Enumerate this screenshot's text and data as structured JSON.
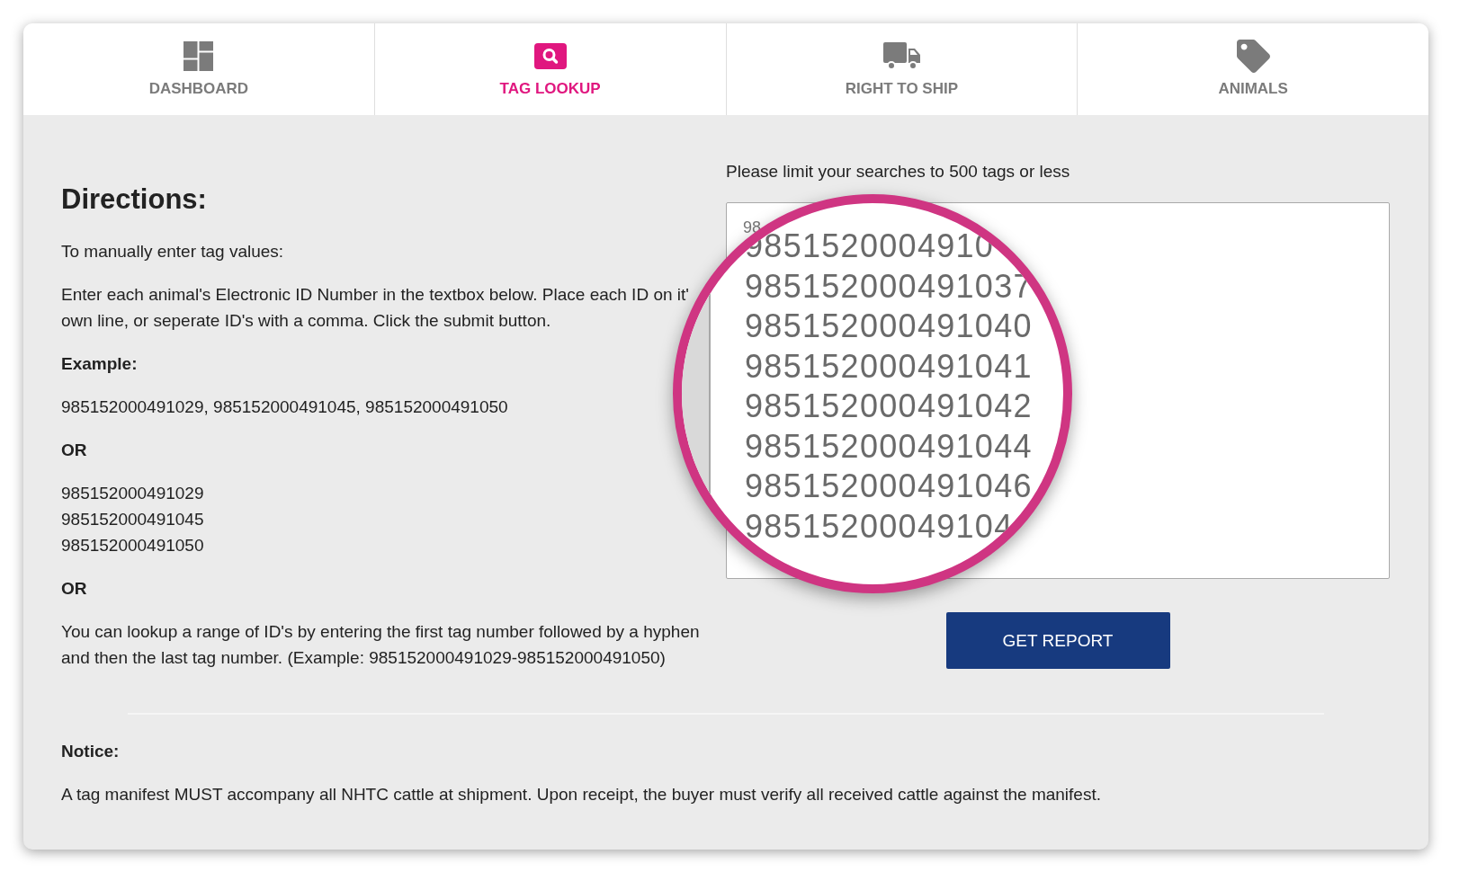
{
  "tabs": [
    {
      "label": "DASHBOARD",
      "selected": false
    },
    {
      "label": "TAG LOOKUP",
      "selected": true
    },
    {
      "label": "RIGHT TO SHIP",
      "selected": false
    },
    {
      "label": "ANIMALS",
      "selected": false
    }
  ],
  "directions": {
    "title": "Directions:",
    "blocks": [
      {
        "kind": "text",
        "text": "To manually enter tag values:"
      },
      {
        "kind": "lines",
        "lines": [
          "Enter each animal's Electronic ID Number in the textbox below. Place each ID on it'",
          "own line, or seperate ID's with a comma. Click the submit button."
        ]
      },
      {
        "kind": "heading",
        "text": "Example:"
      },
      {
        "kind": "text",
        "text": "985152000491029, 985152000491045, 985152000491050"
      },
      {
        "kind": "heading",
        "text": "OR"
      },
      {
        "kind": "lines",
        "lines": [
          "985152000491029",
          "985152000491045",
          "985152000491050"
        ]
      },
      {
        "kind": "heading",
        "text": "OR"
      },
      {
        "kind": "text",
        "text": "You can lookup a range of ID's by entering the first tag number followed by a hyphen and then the last tag number. (Example: 985152000491029-985152000491050)"
      }
    ]
  },
  "search": {
    "limit_note": "Please limit your searches to 500 tags or less",
    "value": "98",
    "button": "GET REPORT"
  },
  "magnifier": {
    "lines": [
      "9851520004910",
      "985152000491037",
      "985152000491040",
      "985152000491041",
      "985152000491042",
      "985152000491044",
      "985152000491046",
      "98515200049104"
    ]
  },
  "notice": {
    "title": "Notice:",
    "text": "A tag manifest MUST accompany all NHTC cattle at shipment. Upon receipt, the buyer must verify all received cattle against the manifest."
  }
}
